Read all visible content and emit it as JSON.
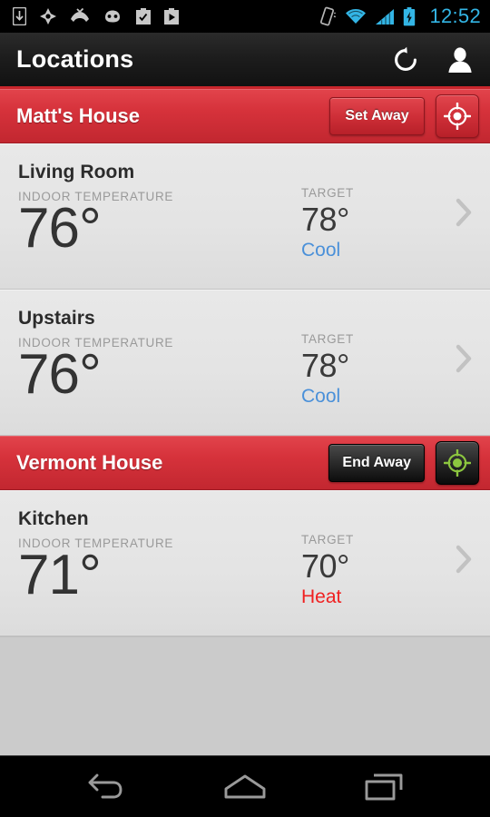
{
  "statusbar": {
    "left_icons": [
      "download-icon",
      "gps-location-icon",
      "missed-call-icon",
      "android-head-icon",
      "clipboard-check-icon",
      "clipboard-play-icon"
    ],
    "right_icons": [
      "vibrate-icon",
      "wifi-icon",
      "cellular-signal-icon",
      "battery-charging-icon"
    ],
    "clock": "12:52",
    "clock_color": "#33b5e5"
  },
  "header": {
    "title": "Locations",
    "refresh_icon": "refresh-icon",
    "account_icon": "person-account-icon",
    "accent_color": "#c9262c"
  },
  "locations": [
    {
      "name": "Matt's House",
      "away_button": "Set Away",
      "away_button_style": "red",
      "target_icon": "crosshair-target-icon",
      "target_icon_color": "#ffffff",
      "target_button_style": "red",
      "thermostats": [
        {
          "room": "Living Room",
          "indoor_label": "INDOOR TEMPERATURE",
          "indoor_temp": "76°",
          "target_label": "TARGET",
          "target_temp": "78°",
          "mode": "Cool",
          "mode_color": "#4a90d9",
          "chevron_icon": "chevron-right-icon"
        },
        {
          "room": "Upstairs",
          "indoor_label": "INDOOR TEMPERATURE",
          "indoor_temp": "76°",
          "target_label": "TARGET",
          "target_temp": "78°",
          "mode": "Cool",
          "mode_color": "#4a90d9",
          "chevron_icon": "chevron-right-icon"
        }
      ]
    },
    {
      "name": "Vermont House",
      "away_button": "End Away",
      "away_button_style": "dark",
      "target_icon": "crosshair-target-icon",
      "target_icon_color": "#8cc63f",
      "target_button_style": "dark",
      "thermostats": [
        {
          "room": "Kitchen",
          "indoor_label": "INDOOR TEMPERATURE",
          "indoor_temp": "71°",
          "target_label": "TARGET",
          "target_temp": "70°",
          "mode": "Heat",
          "mode_color": "#f02020",
          "chevron_icon": "chevron-right-icon"
        }
      ]
    }
  ],
  "navbar": {
    "back": "back-icon",
    "home": "home-icon",
    "recents": "recents-icon"
  }
}
